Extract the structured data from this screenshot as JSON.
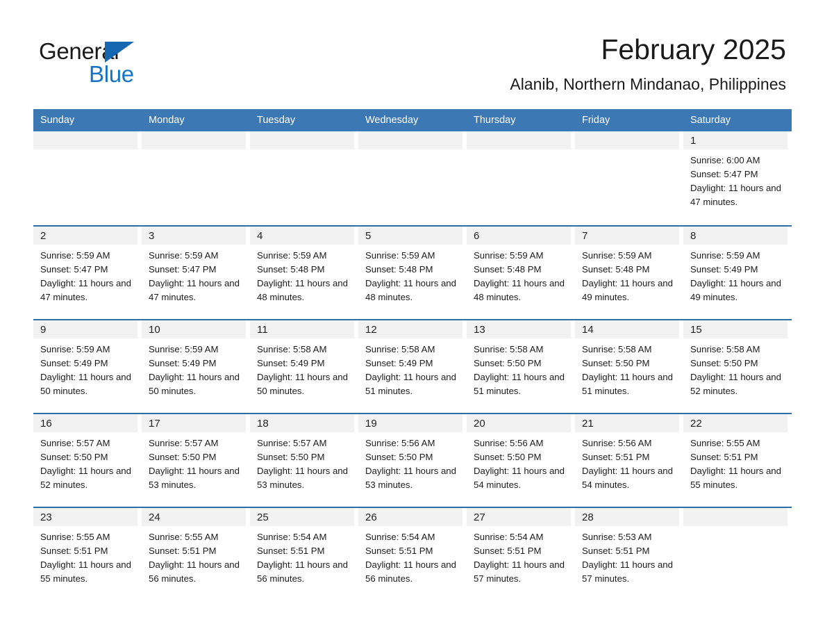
{
  "brand": {
    "word_general": "General",
    "word_blue": "Blue",
    "logo_color": "#1574c4",
    "triangle_color": "#1667b2"
  },
  "header": {
    "title": "February 2025",
    "subtitle": "Alanib, Northern Mindanao, Philippines"
  },
  "theme": {
    "header_row_bg": "#3c78b4",
    "week_divider": "#2f6da8",
    "day_number_bg": "#f2f2f2",
    "text_color": "#1b1b1b"
  },
  "weekdays": [
    "Sunday",
    "Monday",
    "Tuesday",
    "Wednesday",
    "Thursday",
    "Friday",
    "Saturday"
  ],
  "weeks": [
    [
      {
        "day": "",
        "empty": true
      },
      {
        "day": "",
        "empty": true
      },
      {
        "day": "",
        "empty": true
      },
      {
        "day": "",
        "empty": true
      },
      {
        "day": "",
        "empty": true
      },
      {
        "day": "",
        "empty": true
      },
      {
        "day": "1",
        "sunrise": "Sunrise: 6:00 AM",
        "sunset": "Sunset: 5:47 PM",
        "daylight": "Daylight: 11 hours and 47 minutes."
      }
    ],
    [
      {
        "day": "2",
        "sunrise": "Sunrise: 5:59 AM",
        "sunset": "Sunset: 5:47 PM",
        "daylight": "Daylight: 11 hours and 47 minutes."
      },
      {
        "day": "3",
        "sunrise": "Sunrise: 5:59 AM",
        "sunset": "Sunset: 5:47 PM",
        "daylight": "Daylight: 11 hours and 47 minutes."
      },
      {
        "day": "4",
        "sunrise": "Sunrise: 5:59 AM",
        "sunset": "Sunset: 5:48 PM",
        "daylight": "Daylight: 11 hours and 48 minutes."
      },
      {
        "day": "5",
        "sunrise": "Sunrise: 5:59 AM",
        "sunset": "Sunset: 5:48 PM",
        "daylight": "Daylight: 11 hours and 48 minutes."
      },
      {
        "day": "6",
        "sunrise": "Sunrise: 5:59 AM",
        "sunset": "Sunset: 5:48 PM",
        "daylight": "Daylight: 11 hours and 48 minutes."
      },
      {
        "day": "7",
        "sunrise": "Sunrise: 5:59 AM",
        "sunset": "Sunset: 5:48 PM",
        "daylight": "Daylight: 11 hours and 49 minutes."
      },
      {
        "day": "8",
        "sunrise": "Sunrise: 5:59 AM",
        "sunset": "Sunset: 5:49 PM",
        "daylight": "Daylight: 11 hours and 49 minutes."
      }
    ],
    [
      {
        "day": "9",
        "sunrise": "Sunrise: 5:59 AM",
        "sunset": "Sunset: 5:49 PM",
        "daylight": "Daylight: 11 hours and 50 minutes."
      },
      {
        "day": "10",
        "sunrise": "Sunrise: 5:59 AM",
        "sunset": "Sunset: 5:49 PM",
        "daylight": "Daylight: 11 hours and 50 minutes."
      },
      {
        "day": "11",
        "sunrise": "Sunrise: 5:58 AM",
        "sunset": "Sunset: 5:49 PM",
        "daylight": "Daylight: 11 hours and 50 minutes."
      },
      {
        "day": "12",
        "sunrise": "Sunrise: 5:58 AM",
        "sunset": "Sunset: 5:49 PM",
        "daylight": "Daylight: 11 hours and 51 minutes."
      },
      {
        "day": "13",
        "sunrise": "Sunrise: 5:58 AM",
        "sunset": "Sunset: 5:50 PM",
        "daylight": "Daylight: 11 hours and 51 minutes."
      },
      {
        "day": "14",
        "sunrise": "Sunrise: 5:58 AM",
        "sunset": "Sunset: 5:50 PM",
        "daylight": "Daylight: 11 hours and 51 minutes."
      },
      {
        "day": "15",
        "sunrise": "Sunrise: 5:58 AM",
        "sunset": "Sunset: 5:50 PM",
        "daylight": "Daylight: 11 hours and 52 minutes."
      }
    ],
    [
      {
        "day": "16",
        "sunrise": "Sunrise: 5:57 AM",
        "sunset": "Sunset: 5:50 PM",
        "daylight": "Daylight: 11 hours and 52 minutes."
      },
      {
        "day": "17",
        "sunrise": "Sunrise: 5:57 AM",
        "sunset": "Sunset: 5:50 PM",
        "daylight": "Daylight: 11 hours and 53 minutes."
      },
      {
        "day": "18",
        "sunrise": "Sunrise: 5:57 AM",
        "sunset": "Sunset: 5:50 PM",
        "daylight": "Daylight: 11 hours and 53 minutes."
      },
      {
        "day": "19",
        "sunrise": "Sunrise: 5:56 AM",
        "sunset": "Sunset: 5:50 PM",
        "daylight": "Daylight: 11 hours and 53 minutes."
      },
      {
        "day": "20",
        "sunrise": "Sunrise: 5:56 AM",
        "sunset": "Sunset: 5:50 PM",
        "daylight": "Daylight: 11 hours and 54 minutes."
      },
      {
        "day": "21",
        "sunrise": "Sunrise: 5:56 AM",
        "sunset": "Sunset: 5:51 PM",
        "daylight": "Daylight: 11 hours and 54 minutes."
      },
      {
        "day": "22",
        "sunrise": "Sunrise: 5:55 AM",
        "sunset": "Sunset: 5:51 PM",
        "daylight": "Daylight: 11 hours and 55 minutes."
      }
    ],
    [
      {
        "day": "23",
        "sunrise": "Sunrise: 5:55 AM",
        "sunset": "Sunset: 5:51 PM",
        "daylight": "Daylight: 11 hours and 55 minutes."
      },
      {
        "day": "24",
        "sunrise": "Sunrise: 5:55 AM",
        "sunset": "Sunset: 5:51 PM",
        "daylight": "Daylight: 11 hours and 56 minutes."
      },
      {
        "day": "25",
        "sunrise": "Sunrise: 5:54 AM",
        "sunset": "Sunset: 5:51 PM",
        "daylight": "Daylight: 11 hours and 56 minutes."
      },
      {
        "day": "26",
        "sunrise": "Sunrise: 5:54 AM",
        "sunset": "Sunset: 5:51 PM",
        "daylight": "Daylight: 11 hours and 56 minutes."
      },
      {
        "day": "27",
        "sunrise": "Sunrise: 5:54 AM",
        "sunset": "Sunset: 5:51 PM",
        "daylight": "Daylight: 11 hours and 57 minutes."
      },
      {
        "day": "28",
        "sunrise": "Sunrise: 5:53 AM",
        "sunset": "Sunset: 5:51 PM",
        "daylight": "Daylight: 11 hours and 57 minutes."
      },
      {
        "day": "",
        "empty": true
      }
    ]
  ]
}
